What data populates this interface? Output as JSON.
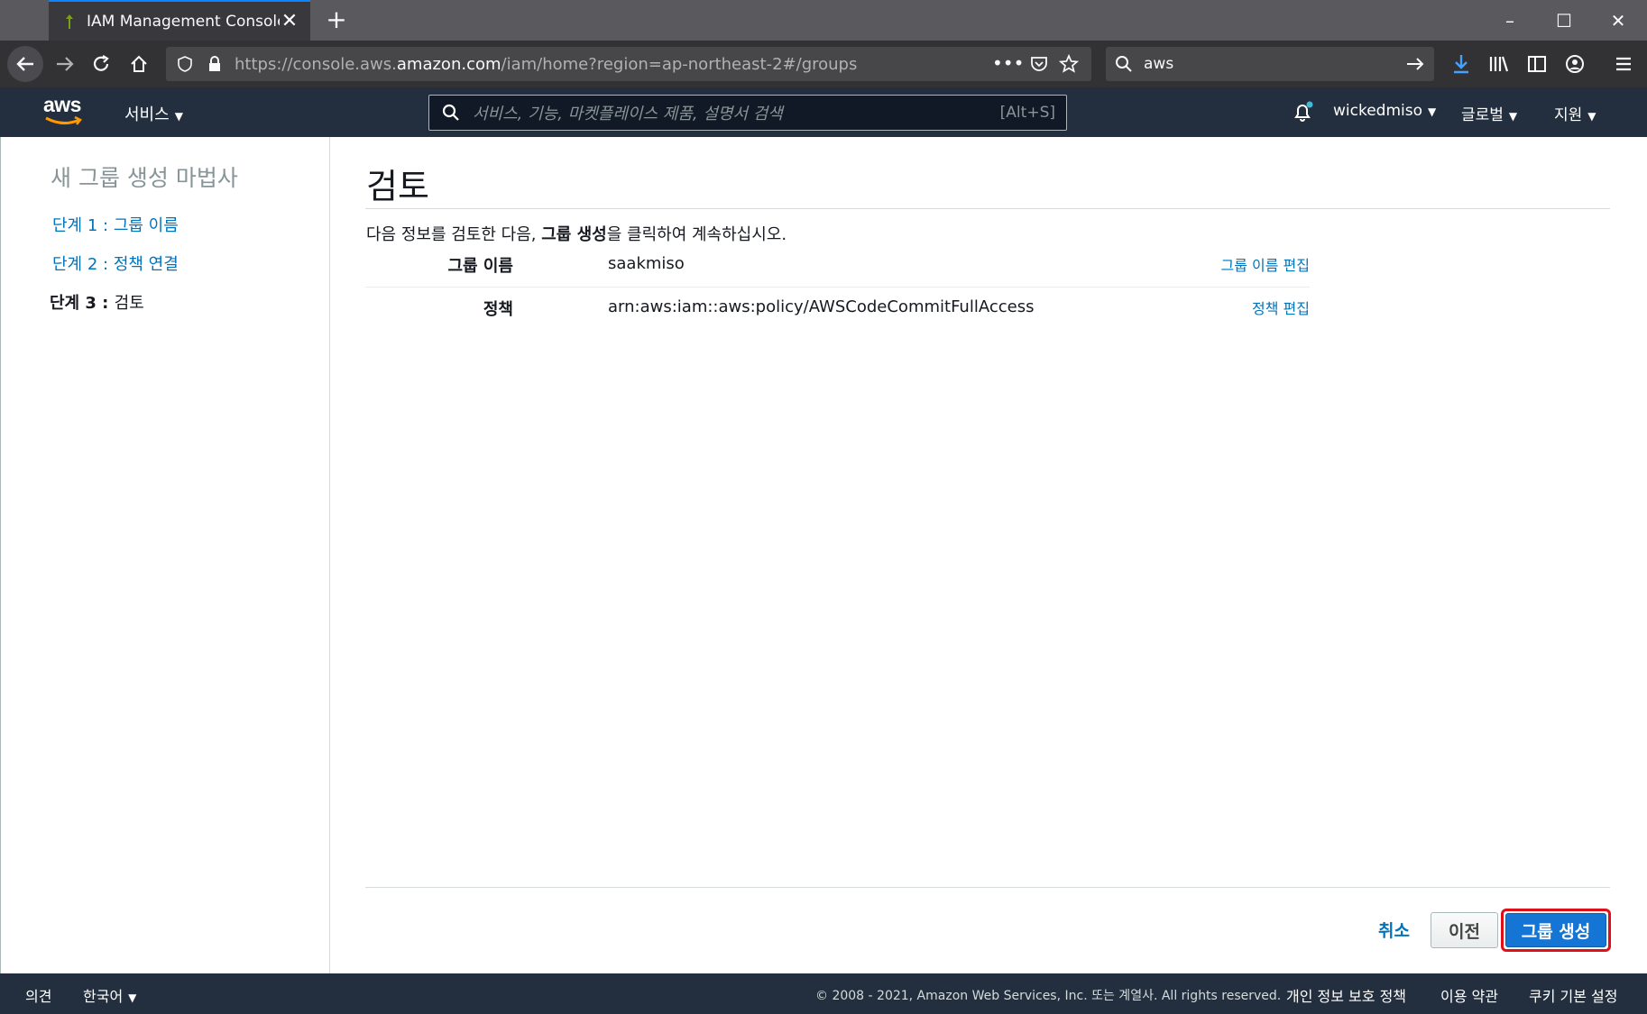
{
  "browser": {
    "tab_title": "IAM Management Console",
    "url_prefix": "https://console.aws.",
    "url_domain": "amazon.com",
    "url_path": "/iam/home?region=ap-northeast-2#/groups",
    "search_value": "aws"
  },
  "aws_header": {
    "logo_text": "aws",
    "services_label": "서비스",
    "search_placeholder": "서비스, 기능, 마켓플레이스 제품, 설명서 검색",
    "search_shortcut": "[Alt+S]",
    "account": "wickedmiso",
    "region": "글로벌",
    "support": "지원"
  },
  "sidebar": {
    "title": "새 그룹 생성 마법사",
    "steps": [
      {
        "prefix": "단계 1 : ",
        "label": "그룹 이름"
      },
      {
        "prefix": "단계 2 : ",
        "label": "정책 연결"
      },
      {
        "prefix": "단계 3 : ",
        "label": "검토"
      }
    ]
  },
  "main": {
    "title": "검토",
    "instruction_before": "다음 정보를 검토한 다음, ",
    "instruction_bold": "그룹 생성",
    "instruction_after": "을 클릭하여 계속하십시오.",
    "rows": [
      {
        "label": "그룹 이름",
        "value": "saakmiso",
        "edit": "그룹 이름 편집"
      },
      {
        "label": "정책",
        "value": "arn:aws:iam::aws:policy/AWSCodeCommitFullAccess",
        "edit": "정책 편집"
      }
    ],
    "cancel": "취소",
    "previous": "이전",
    "create": "그룹 생성"
  },
  "footer": {
    "feedback": "의견",
    "language": "한국어",
    "copyright": "© 2008 - 2021, Amazon Web Services, Inc. 또는 계열사. All rights reserved.",
    "privacy": "개인 정보 보호 정책",
    "terms": "이용 약관",
    "cookies": "쿠키 기본 설정"
  }
}
